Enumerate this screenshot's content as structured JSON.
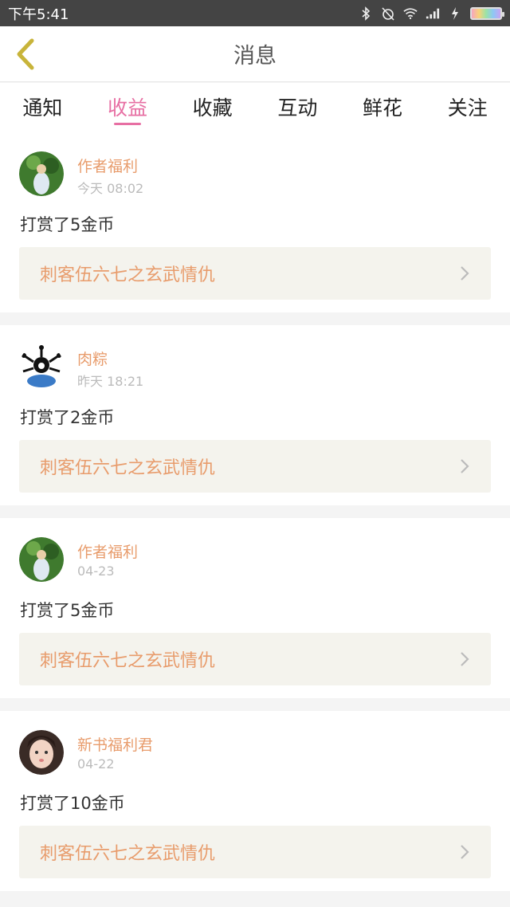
{
  "status_bar": {
    "time": "下午5:41"
  },
  "header": {
    "title": "消息"
  },
  "tabs": [
    {
      "label": "通知",
      "active": false
    },
    {
      "label": "收益",
      "active": true
    },
    {
      "label": "收藏",
      "active": false
    },
    {
      "label": "互动",
      "active": false
    },
    {
      "label": "鲜花",
      "active": false
    },
    {
      "label": "关注",
      "active": false
    }
  ],
  "messages": [
    {
      "user": "作者福利",
      "time": "今天 08:02",
      "text": "打赏了5金币",
      "book": "刺客伍六七之玄武情仇"
    },
    {
      "user": "肉粽",
      "time": "昨天 18:21",
      "text": "打赏了2金币",
      "book": "刺客伍六七之玄武情仇"
    },
    {
      "user": "作者福利",
      "time": "04-23",
      "text": "打赏了5金币",
      "book": "刺客伍六七之玄武情仇"
    },
    {
      "user": "新书福利君",
      "time": "04-22",
      "text": "打赏了10金币",
      "book": "刺客伍六七之玄武情仇"
    }
  ],
  "colors": {
    "accent": "#e76fa3",
    "username": "#e89c6c",
    "card_book_bg": "#f4f3ed"
  }
}
